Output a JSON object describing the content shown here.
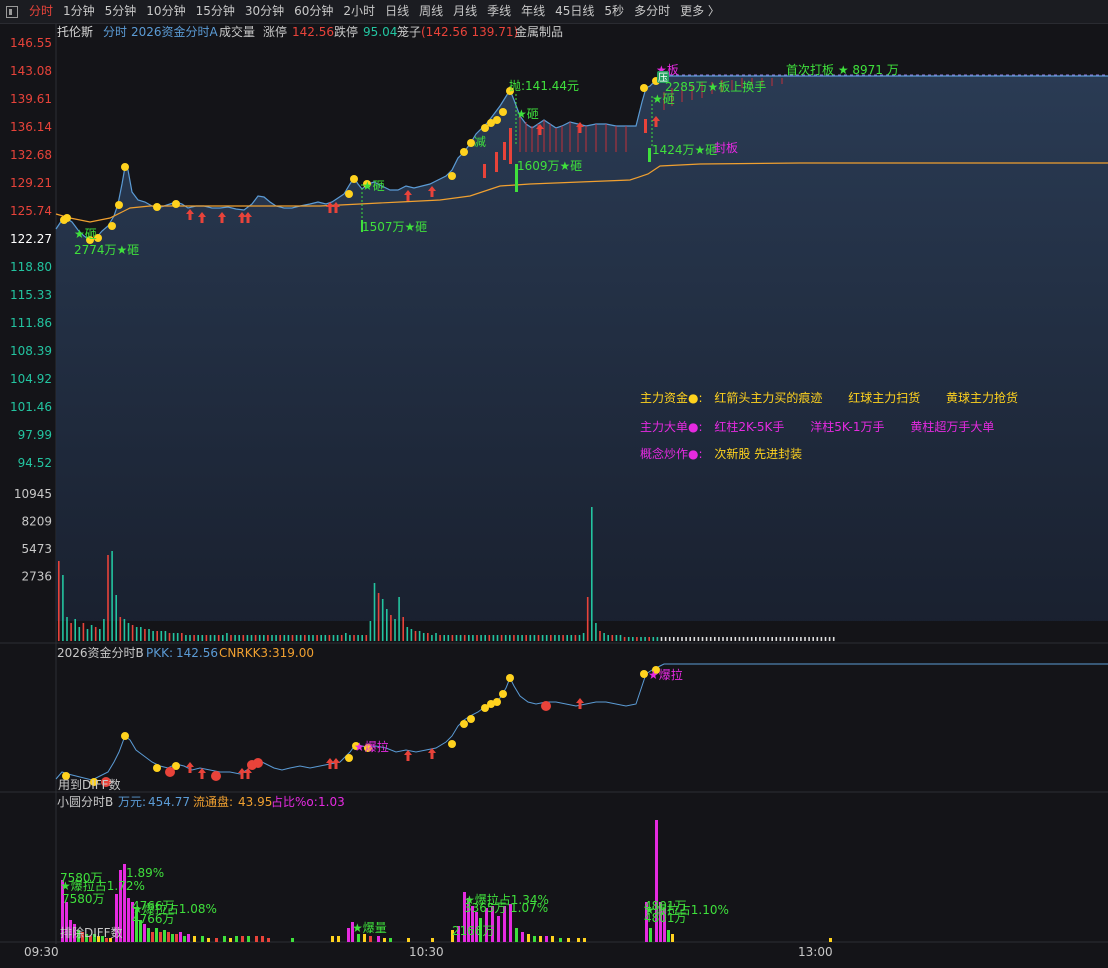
{
  "toolbar": {
    "tabs": [
      "分时",
      "1分钟",
      "5分钟",
      "10分钟",
      "15分钟",
      "30分钟",
      "60分钟",
      "2小时",
      "日线",
      "周线",
      "月线",
      "季线",
      "年线",
      "45日线",
      "5秒",
      "多分时",
      "更多 〉"
    ],
    "active_index": 0
  },
  "header": {
    "stock": "托伦斯",
    "mode": "分时",
    "indicator": "2026资金分时A",
    "vol_label": "成交量",
    "limit_up_label": "涨停",
    "limit_up": "142.56",
    "limit_down_label": "跌停",
    "limit_down": "95.04",
    "cage_label": "笼子",
    "cage_value": "(142.56 139.71)",
    "sector": "金属制品"
  },
  "price_axis": [
    "146.55",
    "143.08",
    "139.61",
    "136.14",
    "132.68",
    "129.21",
    "125.74",
    "122.27",
    "118.80",
    "115.33",
    "111.86",
    "108.39",
    "104.92",
    "101.46",
    "97.99",
    "94.52"
  ],
  "volume_axis": [
    "10945",
    "8209",
    "5473",
    "2736"
  ],
  "time_axis": [
    "09:30",
    "10:30",
    "13:00"
  ],
  "annotations": {
    "a1": "★砸",
    "a2": "2774万★砸",
    "a3": "★砸",
    "a4": "1507万★砸",
    "a5": "抛:141.44元",
    "a6": "★砸",
    "a7": "减",
    "a8": "1609万★砸",
    "a9": "★板",
    "a10": "压",
    "a11": "2285万★板上换手",
    "a12": "★砸",
    "a13": "1424万★砸",
    "a14": "封板",
    "a15": "首次打板 ★ 8971 万"
  },
  "legend": {
    "row1_title": "主力资金●:",
    "row1_items": [
      "红箭头主力买的痕迹",
      "红球主力扫货",
      "黄球主力抢货"
    ],
    "row2_title": "主力大单●:",
    "row2_items": [
      "红柱2K-5K手",
      "洋柱5K-1万手",
      "黄柱超万手大单"
    ],
    "row3_title": "概念炒作●:",
    "row3_value": "次新股 先进封装"
  },
  "panel_b": {
    "name": "2026资金分时B",
    "pkk_label": "PKK:",
    "pkk": "142.56",
    "cn_label": "CNRKK3:",
    "cn": "319.00",
    "note1": "★爆拉",
    "note2": "★爆拉",
    "note3": "用到DIFF数"
  },
  "panel_c": {
    "name": "小圆分时B",
    "unit_label": "万元:",
    "unit": "454.77",
    "float_label": "流通盘:",
    "float": "43.95",
    "ratio_label": "占比%o:",
    "ratio": "1.03",
    "labels": [
      "7580万",
      "★爆拉占1.72%",
      "7580万",
      "1.89%",
      "4766万",
      "★爆拉占1.08%",
      "4766万",
      "★爆拉占1.34%",
      "3365万",
      "1.07%",
      "2166万",
      "★爆量",
      "4801万",
      "★爆拉占1.10%",
      "4801万",
      "排除DIFF数"
    ]
  },
  "colors": {
    "up": "#e8433a",
    "down": "#23c4a0",
    "price_line": "#5b9bd5",
    "avg_line": "#f0a030",
    "yellow": "#ffd21e",
    "magenta": "#e52ae0",
    "green": "#3fe03c",
    "accent": "#e8433a"
  }
}
